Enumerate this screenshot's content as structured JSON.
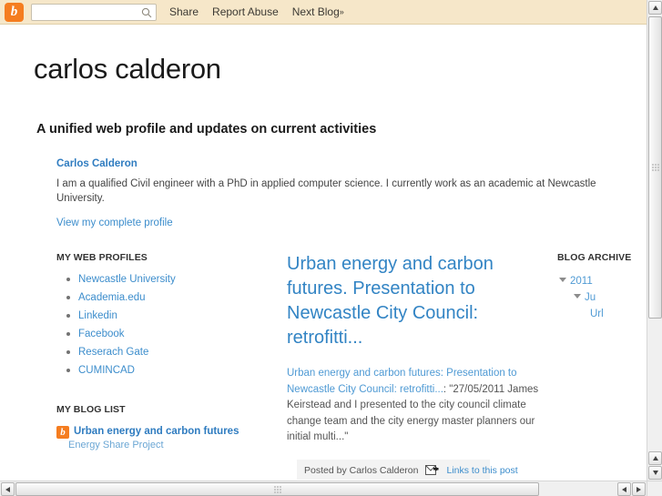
{
  "navbar": {
    "logo_icon": "blogger-b-icon",
    "search": {
      "value": "",
      "placeholder": "",
      "icon": "search-icon"
    },
    "links": [
      {
        "label": "Share"
      },
      {
        "label": "Report Abuse"
      },
      {
        "label": "Next Blog",
        "suffix": "»"
      }
    ]
  },
  "blog": {
    "title": "carlos calderon",
    "description": "A unified web profile and updates on current activities"
  },
  "profile": {
    "name": "Carlos Calderon",
    "bio": "I am a qualified Civil engineer with a PhD in applied computer science. I currently work as an academic at Newcastle University.",
    "view_profile_label": "View my complete profile"
  },
  "web_profiles": {
    "title": "MY WEB PROFILES",
    "items": [
      {
        "label": "Newcastle University"
      },
      {
        "label": "Academia.edu"
      },
      {
        "label": "Linkedin"
      },
      {
        "label": "Facebook"
      },
      {
        "label": "Reserach Gate"
      },
      {
        "label": "CUMINCAD"
      }
    ]
  },
  "blog_list": {
    "title": "MY BLOG LIST",
    "items": [
      {
        "icon": "blogger-b-icon",
        "title": "Urban energy and carbon futures",
        "subtitle": "Energy Share Project"
      }
    ]
  },
  "post": {
    "title": "Urban energy and carbon futures. Presentation to Newcastle City Council: retrofitti...",
    "snippet_link": "Urban energy and carbon futures: Presentation to Newcastle City Council: retrofitti...",
    "snippet_rest": ": \"27/05/2011 James Keirstead and I presented to the city council climate change team and the city energy master planners our initial multi...\"",
    "footer": {
      "posted_by": "Posted by Carlos Calderon",
      "email_icon": "envelope-icon",
      "links_label": "Links to this post"
    }
  },
  "blog_archive": {
    "title": "BLOG ARCHIVE",
    "entries": [
      {
        "level": 1,
        "label": "2011",
        "expanded": true
      },
      {
        "level": 2,
        "label": "Ju",
        "expanded": true
      },
      {
        "level": 3,
        "label": "Url",
        "expanded": false
      }
    ]
  },
  "scrollbars": {
    "vertical": {
      "up_icon": "arrow-up-icon",
      "down_icon": "arrow-down-icon",
      "thumb_grip": "grip-dots"
    },
    "horizontal": {
      "left_icon": "arrow-left-icon",
      "right_icon": "arrow-right-icon",
      "thumb_grip": "grip-dots"
    }
  },
  "colors": {
    "navbar_bg": "#f6e7c9",
    "blogger_orange": "#f57d20",
    "link_blue": "#3c8dcc",
    "post_title_blue": "#3284c4",
    "body_text": "#555555"
  }
}
